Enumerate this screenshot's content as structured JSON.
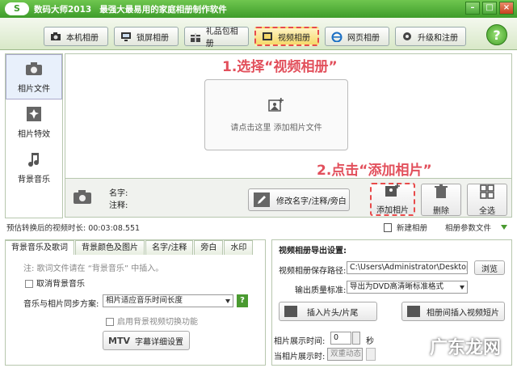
{
  "titlebar": {
    "logo": "S",
    "app_name": "数码大师2013",
    "slogan": "最强大最易用的家庭相册制作软件"
  },
  "tabs": [
    {
      "label": "本机相册",
      "icon": "camera-icon"
    },
    {
      "label": "锁屏相册",
      "icon": "monitor-icon"
    },
    {
      "label": "礼品包相册",
      "icon": "gift-icon"
    },
    {
      "label": "视频相册",
      "icon": "film-icon"
    },
    {
      "label": "网页相册",
      "icon": "ie-icon"
    },
    {
      "label": "升级和注册",
      "icon": "gear-icon"
    }
  ],
  "help_label": "?",
  "sidebar": {
    "items": [
      {
        "label": "相片文件"
      },
      {
        "label": "相片特效"
      },
      {
        "label": "背景音乐"
      }
    ]
  },
  "annotations": {
    "step1": "1.选择“视频相册”",
    "step2": "2.点击“添加相片”"
  },
  "add_area": {
    "text": "请点击这里 添加相片文件"
  },
  "info": {
    "name_label": "名字:",
    "note_label": "注释:"
  },
  "actions": {
    "rename": "修改名字/注释/旁白",
    "add_photo": "添加相片",
    "delete": "删除",
    "select_all": "全选"
  },
  "status": {
    "duration": "预估转换后的视频时长: 00:03:08.551",
    "new_album": "新建相册",
    "album_props": "相册参数文件"
  },
  "left_tabs": [
    "背景音乐及歌词",
    "背景颜色及图片",
    "名字/注释",
    "旁白",
    "水印"
  ],
  "music": {
    "note": "注: 歌词文件请在 “背景音乐” 中插入。",
    "cancel_music": "取消背景音乐",
    "sync_label": "音乐与相片同步方案:",
    "sync_value": "相片适应音乐时间长度",
    "enable_switch": "启用背景视频切换功能",
    "mtv_badge": "MTV",
    "lyrics_settings": "字幕详细设置"
  },
  "export": {
    "header": "视频相册导出设置:",
    "path_label": "视频相册保存路径:",
    "path_value": "C:\\Users\\Administrator\\Desktop",
    "browse": "浏览",
    "quality_label": "输出质量标准:",
    "quality_value": "导出为DVD高清晰标准格式",
    "insert_head": "插入片头/片尾",
    "insert_clip": "相册间插入视频短片",
    "display_time_label": "相片展示时间:",
    "display_time_value": "0",
    "display_time_unit": "秒",
    "current_display_label": "当相片展示时:",
    "current_display_value": "双重动态"
  },
  "watermark": "广东龙网"
}
